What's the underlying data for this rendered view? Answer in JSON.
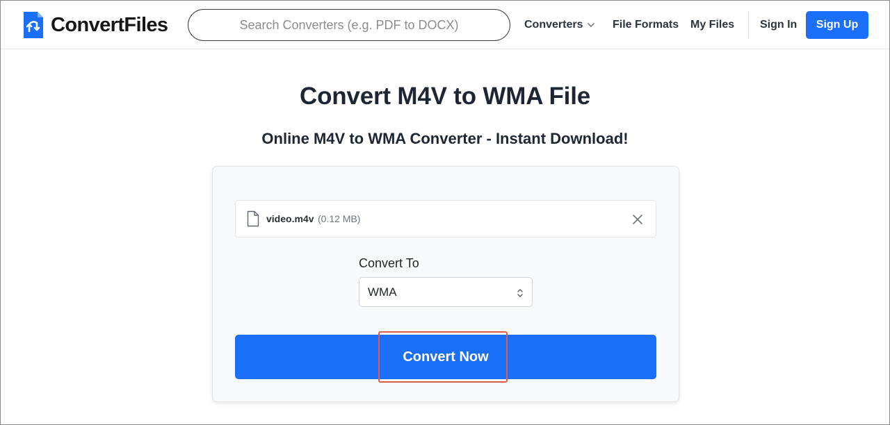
{
  "brand": {
    "name": "ConvertFiles",
    "primary_color": "#1a6ff6"
  },
  "header": {
    "search": {
      "placeholder": "Search Converters (e.g. PDF to DOCX)",
      "value": ""
    },
    "nav": {
      "converters": "Converters",
      "file_formats": "File Formats",
      "my_files": "My Files",
      "sign_in": "Sign In",
      "sign_up": "Sign Up"
    }
  },
  "main": {
    "title": "Convert M4V to WMA File",
    "subtitle": "Online M4V to WMA Converter - Instant Download!",
    "file": {
      "name": "video.m4v",
      "size": "(0.12 MB)",
      "icon": "file-icon",
      "remove_icon": "close-icon"
    },
    "convert_to": {
      "label": "Convert To",
      "selected": "WMA"
    },
    "convert_button": "Convert Now",
    "highlight_color": "#e05a4e"
  }
}
